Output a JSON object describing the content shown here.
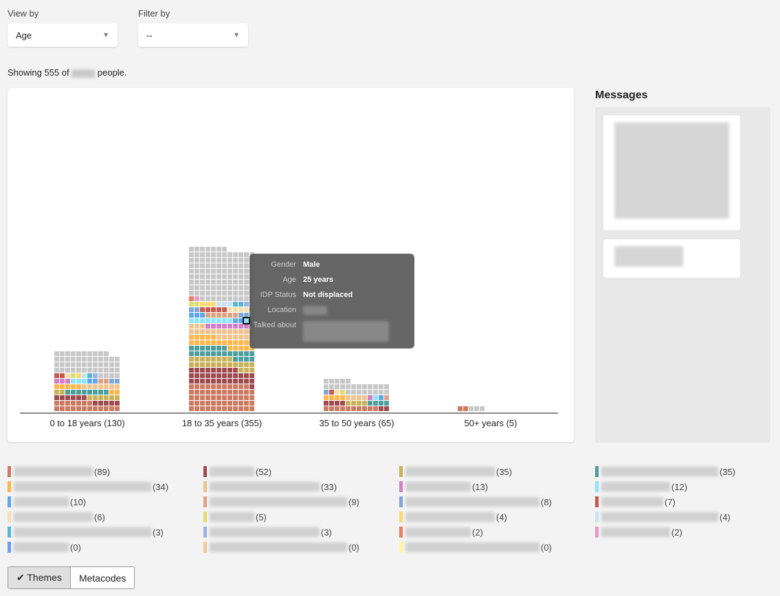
{
  "controls": {
    "view_by_label": "View by",
    "view_by_value": "Age",
    "filter_by_label": "Filter by",
    "filter_by_value": "--"
  },
  "summary": {
    "prefix": "Showing 555 of",
    "suffix": "people."
  },
  "chart_data": {
    "type": "waffle",
    "categories": [
      "0 to 18 years (130)",
      "18 to 35 years (355)",
      "35 to 50 years (65)",
      "50+ years (5)"
    ],
    "values": [
      130,
      355,
      65,
      5
    ],
    "coded_estimate": [
      80,
      242,
      40,
      2
    ],
    "columns": 12,
    "uncoded_color": "#c8c8c8"
  },
  "tooltip": {
    "rows": [
      {
        "k": "Gender",
        "v": "Male"
      },
      {
        "k": "Age",
        "v": "25 years"
      },
      {
        "k": "IDP Status",
        "v": "Not displaced"
      },
      {
        "k": "Location",
        "v": ""
      },
      {
        "k": "Talked about",
        "v": ""
      }
    ]
  },
  "messages": {
    "title": "Messages"
  },
  "legend": [
    {
      "count": "(89)",
      "color": "#cc7a62"
    },
    {
      "count": "(52)",
      "color": "#9e4a50"
    },
    {
      "count": "(35)",
      "color": "#c9b25a"
    },
    {
      "count": "(35)",
      "color": "#4e9e9e"
    },
    {
      "count": "(34)",
      "color": "#ffb74d"
    },
    {
      "count": "(33)",
      "color": "#eec48f"
    },
    {
      "count": "(13)",
      "color": "#d17fc6"
    },
    {
      "count": "(12)",
      "color": "#8fe3fa"
    },
    {
      "count": "(10)",
      "color": "#5ea8ea"
    },
    {
      "count": "(9)",
      "color": "#e0a382"
    },
    {
      "count": "(8)",
      "color": "#7da8d8"
    },
    {
      "count": "(7)",
      "color": "#c65a50"
    },
    {
      "count": "(6)",
      "color": "#f4e0b0"
    },
    {
      "count": "(5)",
      "color": "#e0dd70"
    },
    {
      "count": "(4)",
      "color": "#ffd86e"
    },
    {
      "count": "(4)",
      "color": "#c5e3fa"
    },
    {
      "count": "(3)",
      "color": "#58b8d4"
    },
    {
      "count": "(3)",
      "color": "#9ab2e6"
    },
    {
      "count": "(2)",
      "color": "#e8805e"
    },
    {
      "count": "(2)",
      "color": "#e39ac8"
    },
    {
      "count": "(0)",
      "color": "#6f9df0"
    },
    {
      "count": "(0)",
      "color": "#f0c89a"
    },
    {
      "count": "(0)",
      "color": "#fff59a"
    }
  ],
  "buttons": {
    "themes": "✔ Themes",
    "metacodes": "Metacodes"
  }
}
